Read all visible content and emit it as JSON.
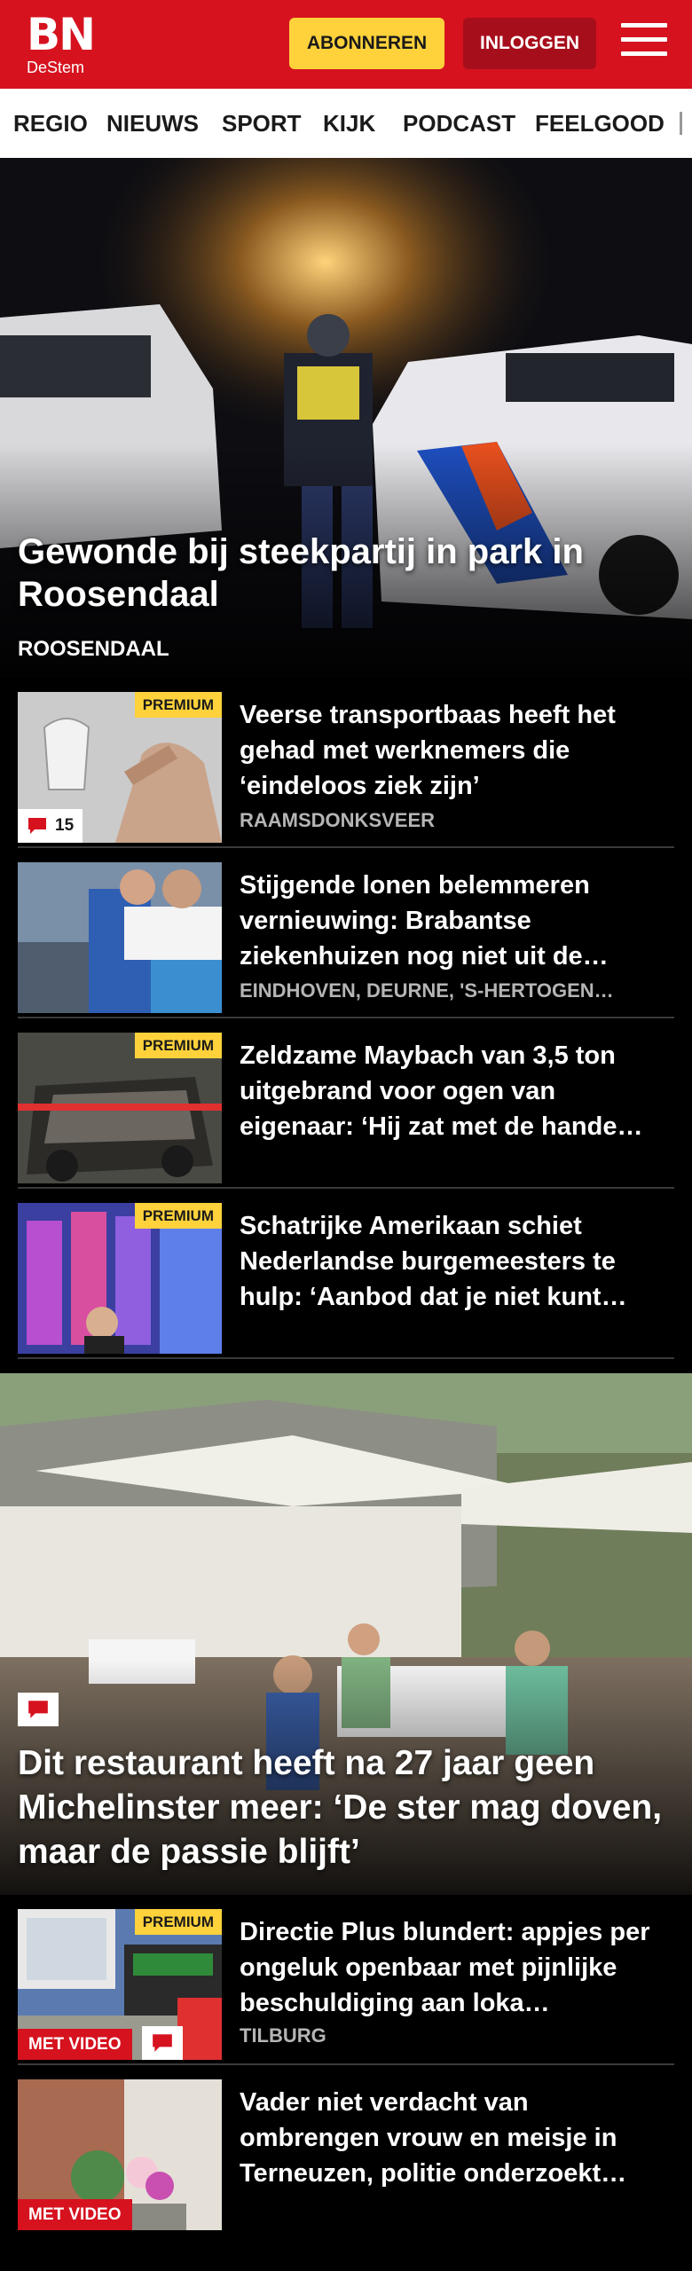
{
  "header": {
    "logo_line1": "BN",
    "logo_line2": "DeStem",
    "subscribe_label": "ABONNEREN",
    "login_label": "INLOGGEN",
    "brand_color": "#d6121f",
    "accent_color": "#ffd23b"
  },
  "nav": {
    "items": [
      "REGIO",
      "NIEUWS",
      "SPORT",
      "KIJK",
      "PODCAST",
      "FEELGOOD"
    ]
  },
  "hero": {
    "title": "Gewonde bij steekpartij in park in Roosendaal",
    "location": "ROOSENDAAL"
  },
  "articles": [
    {
      "title": "Veerse transportbaas heeft het gehad met werknemers die ‘eindeloos ziek zijn’",
      "location": "RAAMSDONKSVEER",
      "premium": "PREMIUM",
      "comments": "15"
    },
    {
      "title": "Stijgende lonen belemmeren vernieuwing: Brabantse ziekenhuizen nog niet uit de…",
      "location": "EINDHOVEN, DEURNE, 'S-HERTOGEN…"
    },
    {
      "title": "Zeldzame Maybach van 3,5 ton uitgebrand voor ogen van eigenaar: ‘Hij zat met de hande…",
      "premium": "PREMIUM"
    },
    {
      "title": "Schatrijke Amerikaan schiet Nederlandse burgemeesters te hulp: ‘Aanbod dat je niet kunt…",
      "premium": "PREMIUM"
    }
  ],
  "feature": {
    "title": "Dit restaurant heeft na 27 jaar geen Michelinster meer: ‘De ster mag doven, maar de passie blijft’"
  },
  "articles_bottom": [
    {
      "title": "Directie Plus blundert: appjes per ongeluk openbaar met pijnlijke beschuldiging aan loka…",
      "location": "TILBURG",
      "premium": "PREMIUM",
      "video": "MET VIDEO"
    },
    {
      "title": "Vader niet verdacht van ombrengen vrouw en meisje in Terneuzen, politie onderzoekt…",
      "video": "MET VIDEO"
    }
  ]
}
